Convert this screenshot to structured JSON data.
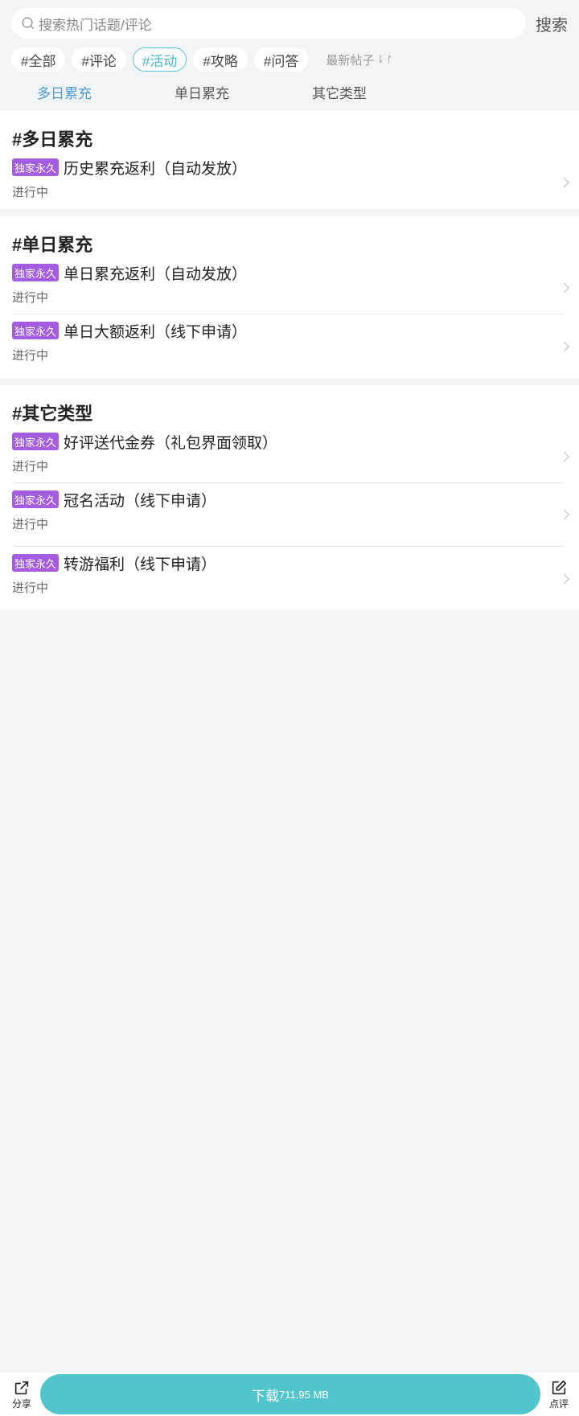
{
  "search": {
    "placeholder": "搜索热门话题/评论",
    "button": "搜索"
  },
  "tags": [
    {
      "label": "#全部",
      "active": false
    },
    {
      "label": "#评论",
      "active": false
    },
    {
      "label": "#活动",
      "active": true
    },
    {
      "label": "#攻略",
      "active": false
    },
    {
      "label": "#问答",
      "active": false
    }
  ],
  "sort": {
    "label": "最新帖子",
    "icon": "sort-arrows-icon"
  },
  "subtabs": [
    {
      "label": "多日累充",
      "active": true
    },
    {
      "label": "单日累充",
      "active": false
    },
    {
      "label": "其它类型",
      "active": false
    }
  ],
  "sections": [
    {
      "title": "#多日累充",
      "items": [
        {
          "badge": "独家永久",
          "title": "历史累充返利（自动发放）",
          "status": "进行中"
        }
      ]
    },
    {
      "title": "#单日累充",
      "items": [
        {
          "badge": "独家永久",
          "title": "单日累充返利（自动发放）",
          "status": "进行中"
        },
        {
          "badge": "独家永久",
          "title": "单日大额返利（线下申请）",
          "status": "进行中"
        }
      ]
    },
    {
      "title": "#其它类型",
      "items": [
        {
          "badge": "独家永久",
          "title": "好评送代金券（礼包界面领取）",
          "status": "进行中"
        },
        {
          "badge": "独家永久",
          "title": "冠名活动（线下申请）",
          "status": "进行中"
        },
        {
          "badge": "独家永久",
          "title": "转游福利（线下申请）",
          "status": "进行中"
        }
      ]
    }
  ],
  "bottom": {
    "share": "分享",
    "download": "下载",
    "size": "711.95 MB",
    "review": "点评"
  },
  "colors": {
    "accent": "#52c4cb",
    "badge": "#a45ce0",
    "active_tab": "#4a9bd8"
  }
}
